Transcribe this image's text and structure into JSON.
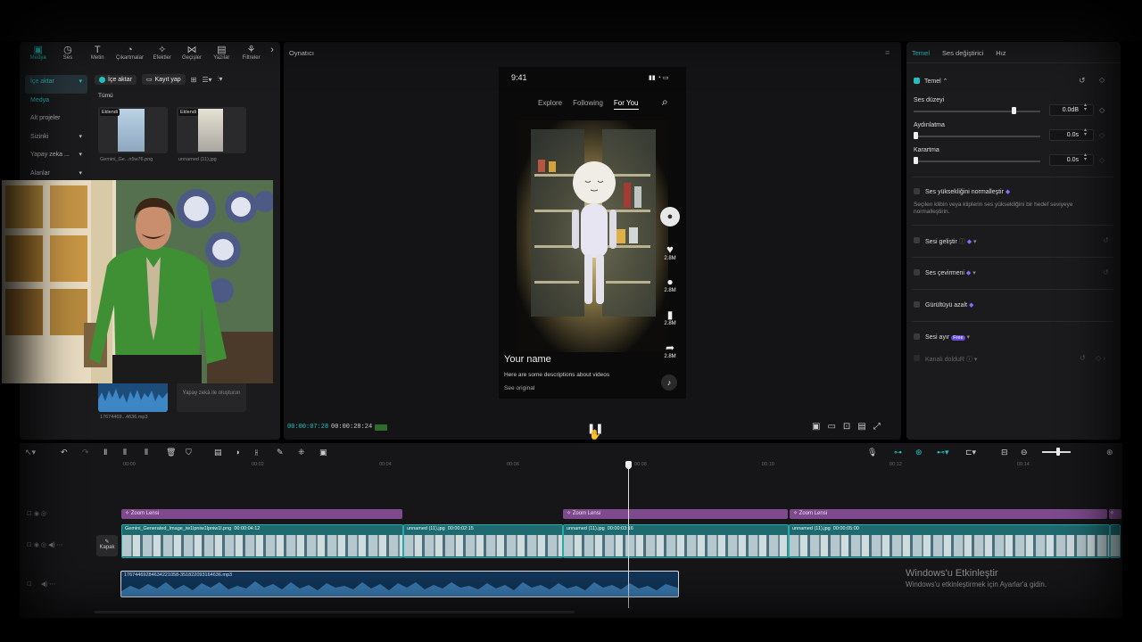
{
  "colors": {
    "accent": "#22c3c3",
    "zoom_clip": "#7e4a8d",
    "video_clip": "#1f6a6f",
    "audio_clip": "#12365a",
    "pro_gem": "#8a6bff"
  },
  "media_tabs": [
    {
      "label": "Medya",
      "icon": "media-icon"
    },
    {
      "label": "Ses",
      "icon": "audio-icon"
    },
    {
      "label": "Metin",
      "icon": "text-icon"
    },
    {
      "label": "Çıkartmalar",
      "icon": "sticker-icon"
    },
    {
      "label": "Efektler",
      "icon": "effects-icon"
    },
    {
      "label": "Geçişler",
      "icon": "transitions-icon"
    },
    {
      "label": "Yazılar",
      "icon": "captions-icon"
    },
    {
      "label": "Filtreler",
      "icon": "filters-icon"
    }
  ],
  "sidenav": [
    "İçe aktar",
    "Medya",
    "Alt projeler",
    "Sizinki",
    "Yapay zeka ...",
    "Alanlar"
  ],
  "media": {
    "import_label": "İçe aktar",
    "record_label": "Kayıt yap",
    "filter_label": "Tümü",
    "added_tag": "Eklendi",
    "items": [
      "Gemini_Ge...n5w76.png",
      "unnamed (11).jpg"
    ],
    "audio_item": "17674469...4636.mp3",
    "ai_box": "Yapay zekâ ile oluşturun"
  },
  "player": {
    "title": "Oynatıcı",
    "current_time": "00:00:07:28",
    "total_time": "00:00:28:24"
  },
  "phone": {
    "clock": "9:41",
    "nav": [
      "Explore",
      "Following",
      "For You"
    ],
    "counts": [
      "2.8M",
      "2.8M",
      "2.8M",
      "2.8M"
    ],
    "name": "Your name",
    "desc": "Here are some descriptions about videos",
    "see": "See original"
  },
  "right": {
    "tabs": [
      "Temel",
      "Ses değiştirici",
      "Hız"
    ],
    "section": "Temel",
    "volume_label": "Ses düzeyi",
    "volume_value": "0.0dB",
    "volume_level": 0.79,
    "fadein_label": "Aydınlatma",
    "fadein_value": "0.0s",
    "fadeout_label": "Karartma",
    "fadeout_value": "0.0s",
    "normalize_label": "Ses yüksekliğini normalleştir",
    "normalize_desc": "Seçilen klibin veya kliplerin ses yüksekliğini bir hedef seviyeye normalleştirin.",
    "enhance_label": "Sesi geliştir",
    "convert_label": "Ses çevirmeni",
    "denoise_label": "Gürültüyü azalt",
    "separate_label": "Sesi ayır",
    "free_badge": "Free",
    "channel_label": "Kanalı dolduR"
  },
  "timeline": {
    "ruler": [
      "00:00",
      "00:02",
      "00:04",
      "00:06",
      "00:08",
      "00:10",
      "00:12",
      "00:14"
    ],
    "zoom_label": "Zoom Lensi",
    "cover_label": "Kapak",
    "clips": [
      {
        "name": "Gemini_Generated_Image_iw1lpniw1lpniw1l.png",
        "dur": "00:00:04:12"
      },
      {
        "name": "unnamed (11).jpg",
        "dur": "00:00:02:15"
      },
      {
        "name": "unnamed (11).jpg",
        "dur": "00:00:03:16"
      },
      {
        "name": "unnamed (11).jpg",
        "dur": "00:00:05:00"
      }
    ],
    "audio_name": "17674469284634221058-351822093164636.mp3"
  },
  "watermark": {
    "title": "Windows'u Etkinleştir",
    "sub": "Windows'u etkinleştirmek için Ayarlar'a gidin."
  }
}
